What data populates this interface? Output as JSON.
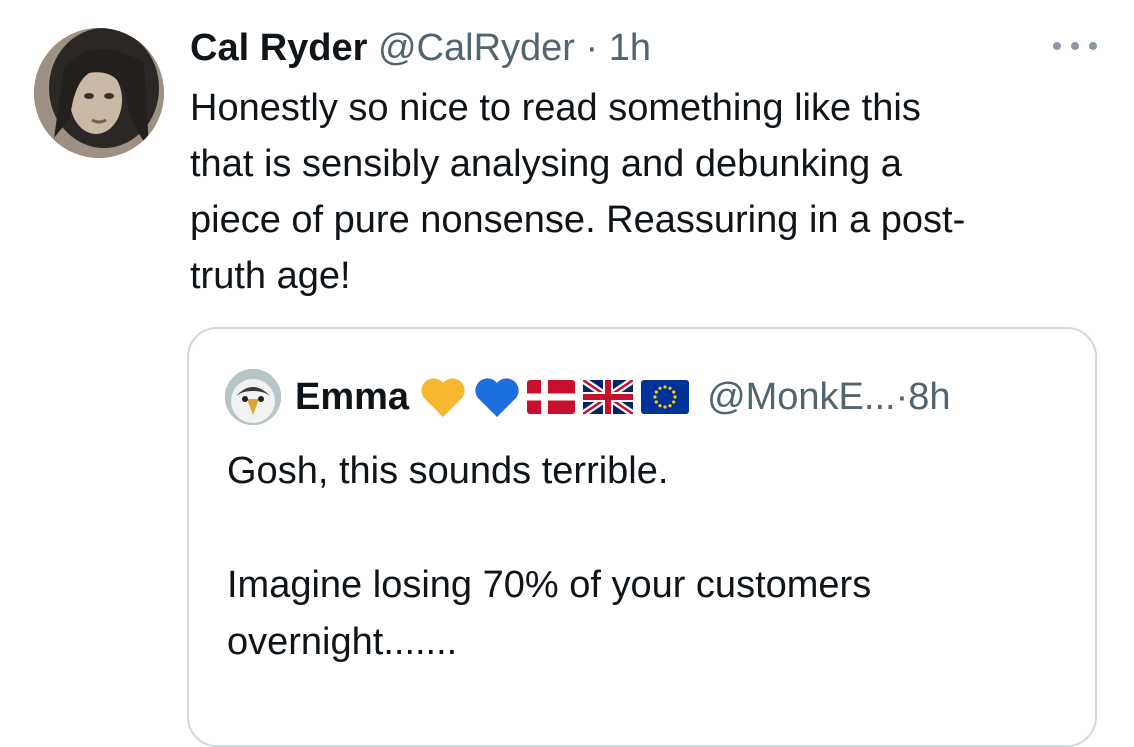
{
  "tweet": {
    "display_name": "Cal Ryder",
    "handle": "@CalRyder",
    "separator": " · ",
    "time": "1h",
    "text": "Honestly so nice to read something like this\nthat is sensibly analysing and debunking a\npiece of pure nonsense. Reassuring in a post-\ntruth age!",
    "more_icon": "more-horizontal-icon"
  },
  "quoted": {
    "display_name": "Emma",
    "badges": [
      "yellow-heart-icon",
      "blue-heart-icon",
      "denmark-flag-icon",
      "uk-flag-icon",
      "eu-flag-icon"
    ],
    "handle": "@MonkE...",
    "separator": " · ",
    "time": "8h",
    "text": "Gosh, this sounds terrible.\n\nImagine losing 70% of your customers\novernight......."
  },
  "colors": {
    "text": "#0f1419",
    "muted": "#536471",
    "border": "#cfd9de",
    "yellow_heart": "#f7b731",
    "blue_heart": "#1d6fe0"
  }
}
